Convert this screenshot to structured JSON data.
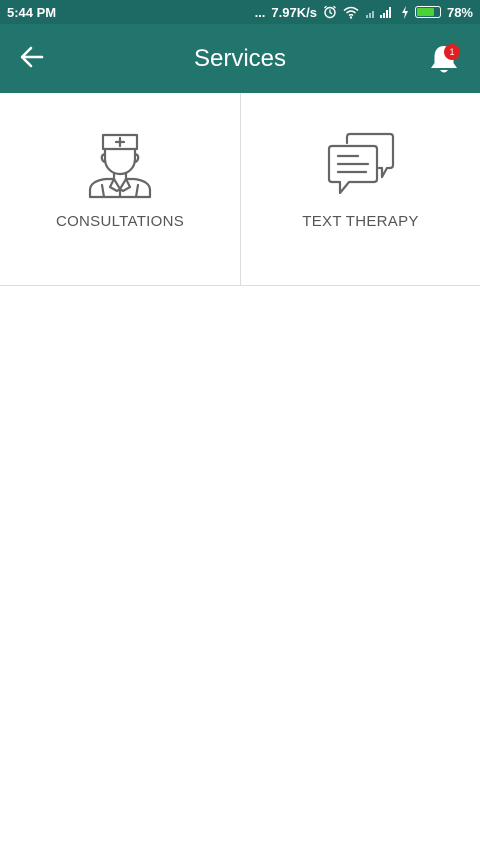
{
  "status_bar": {
    "time": "5:44 PM",
    "dots": "...",
    "speed": "7.97K/s",
    "battery": "78%",
    "battery_level": 0.78,
    "icons": [
      "alarm-icon",
      "wifi-icon",
      "signal-icon",
      "charging-icon",
      "battery-icon"
    ]
  },
  "app_bar": {
    "title": "Services",
    "back_icon": "arrow-left-icon",
    "notification_icon": "bell-icon",
    "notification_count": "1",
    "colors": {
      "status_bar": "#1d6a64",
      "app_bar": "#22756d",
      "badge": "#e02020"
    }
  },
  "services": [
    {
      "label": "CONSULTATIONS",
      "icon": "doctor-icon"
    },
    {
      "label": "TEXT THERAPY",
      "icon": "chat-bubbles-icon"
    }
  ]
}
